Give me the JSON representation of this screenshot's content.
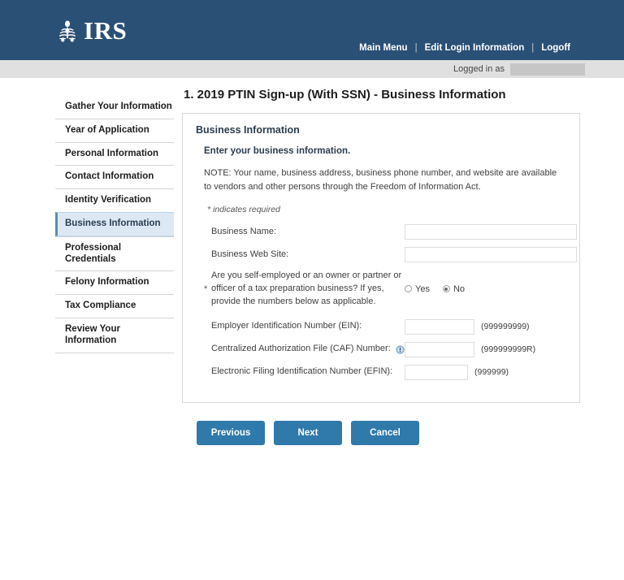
{
  "header": {
    "logo_text": "IRS",
    "logo_icon": "irs-eagle-seal-icon",
    "nav": [
      {
        "label": "Main Menu"
      },
      {
        "label": "Edit Login Information"
      },
      {
        "label": "Logoff"
      }
    ],
    "separator": "|"
  },
  "loginbar": {
    "label": "Logged in as",
    "user_value": ""
  },
  "sidebar": {
    "items": [
      {
        "label": "Gather Your Information",
        "active": false
      },
      {
        "label": "Year of Application",
        "active": false
      },
      {
        "label": "Personal Information",
        "active": false
      },
      {
        "label": "Contact Information",
        "active": false
      },
      {
        "label": "Identity Verification",
        "active": false
      },
      {
        "label": "Business Information",
        "active": true
      },
      {
        "label": "Professional Credentials",
        "active": false
      },
      {
        "label": "Felony Information",
        "active": false
      },
      {
        "label": "Tax Compliance",
        "active": false
      },
      {
        "label": "Review Your Information",
        "active": false
      }
    ]
  },
  "main": {
    "page_title": "1. 2019 PTIN Sign-up (With SSN) - Business Information",
    "panel": {
      "title": "Business Information",
      "subtitle": "Enter your business information.",
      "note": "NOTE: Your name, business address, business phone number, and website are available to vendors and other persons through the Freedom of Information Act.",
      "required_note": "* indicates required"
    },
    "fields": {
      "business_name": {
        "label": "Business Name:",
        "value": "",
        "placeholder": ""
      },
      "business_website": {
        "label": "Business Web Site:",
        "value": "",
        "placeholder": ""
      },
      "self_employed": {
        "required_marker": "*",
        "label": "Are you self-employed or an owner or partner or officer of a tax preparation business? If yes, provide the numbers below as applicable.",
        "options": [
          {
            "label": "Yes",
            "selected": false
          },
          {
            "label": "No",
            "selected": true
          }
        ]
      },
      "ein": {
        "label": "Employer Identification Number (EIN):",
        "value": "",
        "hint": "(999999999)"
      },
      "caf": {
        "label": "Centralized Authorization File (CAF) Number:",
        "value": "",
        "hint": "(999999999R)",
        "help_icon": "info-help-icon"
      },
      "efin": {
        "label": "Electronic Filing Identification Number (EFIN):",
        "value": "",
        "hint": "(999999)"
      }
    },
    "actions": [
      {
        "label": "Previous"
      },
      {
        "label": "Next"
      },
      {
        "label": "Cancel"
      }
    ]
  },
  "colors": {
    "header_bg": "#2a5076",
    "button_bg": "#3079ab",
    "active_sidebar_bg": "#dce9f5",
    "loginbar_bg": "#e0e0e0"
  }
}
